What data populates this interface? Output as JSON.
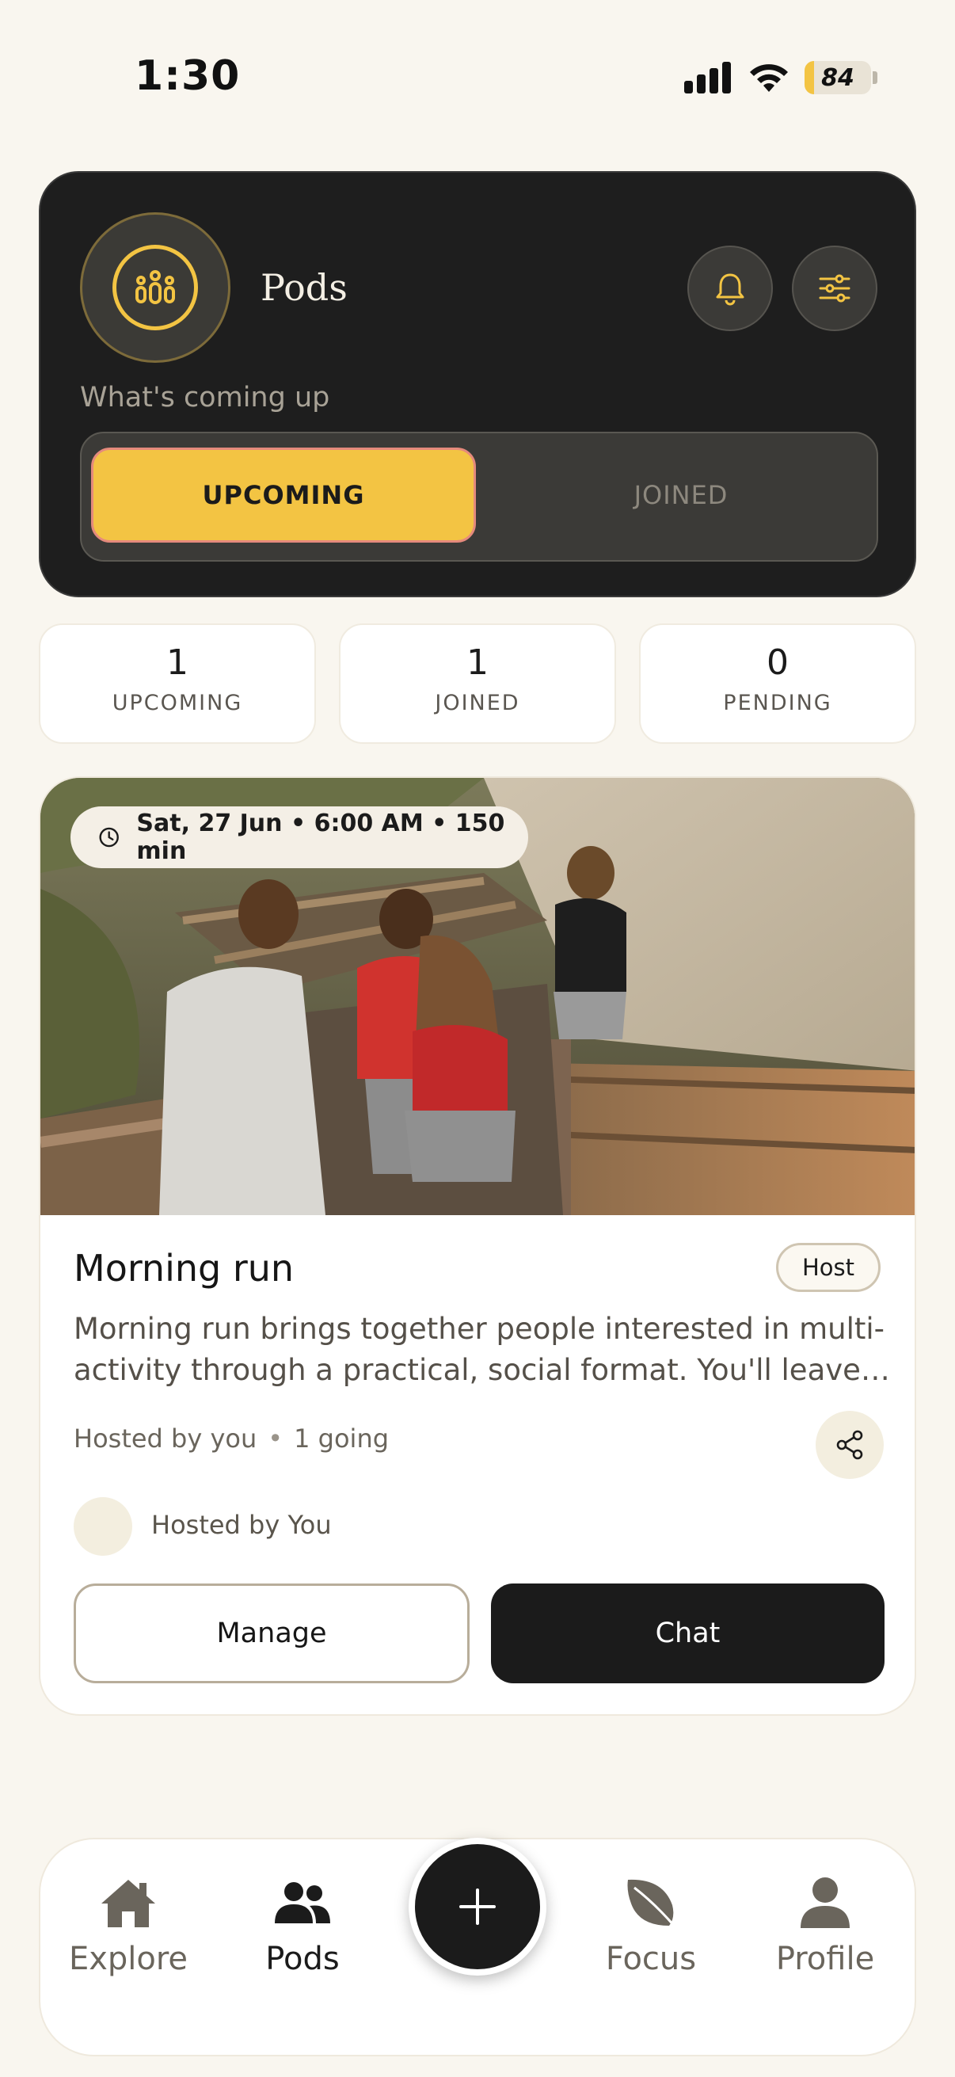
{
  "status_bar": {
    "time": "1:30",
    "battery": "84"
  },
  "header": {
    "title": "Pods",
    "subtitle": "What's coming up",
    "logo_icon": "people-group-icon",
    "bell_icon": "bell-icon",
    "filter_icon": "sliders-icon"
  },
  "segments": {
    "active": "UPCOMING",
    "inactive": "JOINED"
  },
  "stats": [
    {
      "value": "1",
      "label": "UPCOMING"
    },
    {
      "value": "1",
      "label": "JOINED"
    },
    {
      "value": "0",
      "label": "PENDING"
    }
  ],
  "event": {
    "datetime": "Sat, 27 Jun • 6:00 AM • 150 min",
    "title": "Morning run",
    "badge": "Host",
    "description": "Morning run brings together people interested in multi-activity through a practical, social format. You'll leave…",
    "hosted_by": "Hosted by you",
    "separator": "•",
    "going": "1 going",
    "host_name": "Hosted by You",
    "manage_label": "Manage",
    "chat_label": "Chat"
  },
  "nav": [
    {
      "label": "Explore",
      "icon": "home-icon",
      "active": false
    },
    {
      "label": "Pods",
      "icon": "people-icon",
      "active": true
    },
    {
      "label": "Focus",
      "icon": "leaf-icon",
      "active": false
    },
    {
      "label": "Profile",
      "icon": "person-icon",
      "active": false
    }
  ],
  "fab_icon": "plus-icon",
  "colors": {
    "accent": "#f3c443",
    "dark": "#1e1e1e",
    "background": "#f9f6ef"
  }
}
